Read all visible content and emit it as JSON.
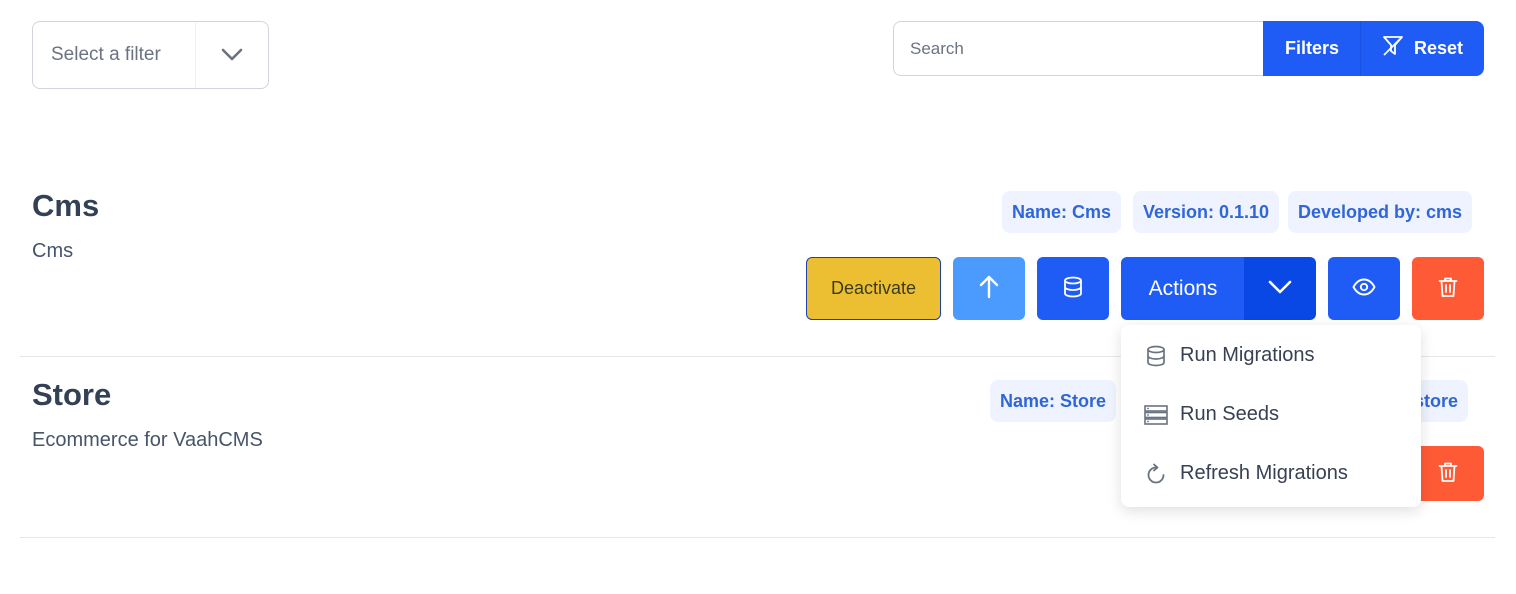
{
  "filter": {
    "placeholder": "Select a filter"
  },
  "search": {
    "placeholder": "Search",
    "value": ""
  },
  "toolbar": {
    "filters_label": "Filters",
    "reset_label": "Reset"
  },
  "modules": [
    {
      "title": "Cms",
      "description": "Cms",
      "tags": [
        "Name: Cms",
        "Version: 0.1.10",
        "Developed by: cms"
      ],
      "deactivate_label": "Deactivate",
      "actions_label": "Actions"
    },
    {
      "title": "Store",
      "description": "Ecommerce for VaahCMS",
      "tags": [
        "Name: Store",
        "store"
      ]
    }
  ],
  "actions_menu": {
    "items": [
      {
        "label": "Run Migrations",
        "icon": "database-icon"
      },
      {
        "label": "Run Seeds",
        "icon": "server-icon"
      },
      {
        "label": "Refresh Migrations",
        "icon": "refresh-icon"
      }
    ]
  },
  "colors": {
    "primary": "#1e5cf5",
    "warning": "#ecbf33",
    "info": "#4b9bff",
    "danger": "#ff5a36",
    "tag_bg": "#eef3ff",
    "tag_text": "#2f66d8"
  }
}
